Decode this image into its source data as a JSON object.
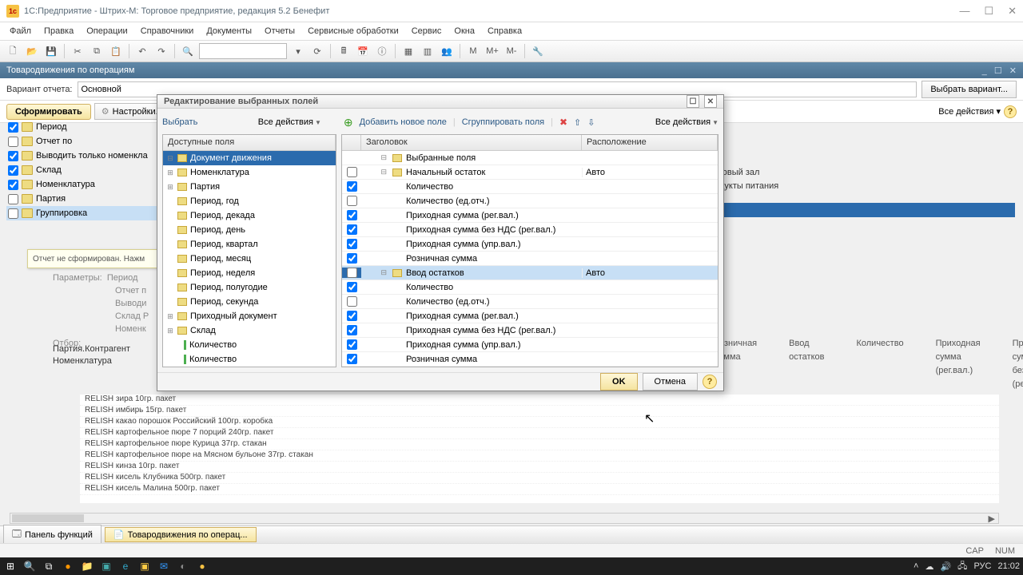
{
  "window": {
    "title": "1С:Предприятие - Штрих-М: Торговое предприятие, редакция 5.2 Бенефит",
    "doc_tab": "Товародвижения по операциям"
  },
  "menu": [
    "Файл",
    "Правка",
    "Операции",
    "Справочники",
    "Документы",
    "Отчеты",
    "Сервисные обработки",
    "Сервис",
    "Окна",
    "Справка"
  ],
  "toolbar_m": [
    "M",
    "M+",
    "M-"
  ],
  "variant": {
    "label": "Вариант отчета:",
    "value": "Основной",
    "choose": "Выбрать вариант..."
  },
  "actions": {
    "run": "Сформировать",
    "settings": "Настройки...",
    "all": "Все действия"
  },
  "left_checks": [
    {
      "checked": true,
      "label": "Период"
    },
    {
      "checked": false,
      "label": "Отчет по"
    },
    {
      "checked": true,
      "label": "Выводить только номенкла"
    },
    {
      "checked": true,
      "label": "Склад"
    },
    {
      "checked": true,
      "label": "Номенклатура"
    },
    {
      "checked": false,
      "label": "Партия"
    },
    {
      "checked": false,
      "label": "Группировка",
      "sel": true
    }
  ],
  "hint": "Отчет не сформирован. Нажм",
  "params": {
    "p_label": "Параметры:",
    "period": "Период",
    "otchet": "Отчет п",
    "vyvod": "Выводи",
    "sklad": "Склад Р",
    "nomen": "Номенк",
    "otbor": "Отбор:",
    "col1": "Партия.Контрагент",
    "col2": "Номенклатура"
  },
  "bg_right": {
    "line1": "говый зал",
    "line2": "дукты питания",
    "cols": [
      "озничная",
      "умма",
      "Ввод остатков",
      "Количество",
      "Приходная",
      "сумма",
      "(рег.вал.)",
      "Приходная сумма",
      "без НДС (рег.вал"
    ]
  },
  "bg_list": [
    "RELISH зира 10гр. пакет",
    "RELISH имбирь 15гр. пакет",
    "RELISH какао порошок Российский 100гр. коробка",
    "RELISH картофельное пюре 7 порций 240гр. пакет",
    "RELISH картофельное пюре Курица 37гр. стакан",
    "RELISH картофельное пюре на Мясном бульоне 37гр. стакан",
    "RELISH кинза 10гр. пакет",
    "RELISH кисель Клубника 500гр. пакет",
    "RELISH кисель Малина 500гр. пакет"
  ],
  "modal": {
    "title": "Редактирование выбранных полей",
    "choose": "Выбрать",
    "all_actions": "Все действия",
    "add_field": "Добавить новое поле",
    "group_fields": "Сгруппировать поля",
    "left_header": "Доступные поля",
    "right_headers": [
      "Заголовок",
      "Расположение"
    ],
    "available": [
      {
        "exp": "⊟",
        "type": "folder",
        "label": "Документ движения",
        "selected": true
      },
      {
        "exp": "⊞",
        "type": "folder",
        "label": "Номенклатура"
      },
      {
        "exp": "⊞",
        "type": "folder",
        "label": "Партия"
      },
      {
        "exp": "",
        "type": "folder",
        "label": "Период, год"
      },
      {
        "exp": "",
        "type": "folder",
        "label": "Период, декада"
      },
      {
        "exp": "",
        "type": "folder",
        "label": "Период, день"
      },
      {
        "exp": "",
        "type": "folder",
        "label": "Период, квартал"
      },
      {
        "exp": "",
        "type": "folder",
        "label": "Период, месяц"
      },
      {
        "exp": "",
        "type": "folder",
        "label": "Период, неделя"
      },
      {
        "exp": "",
        "type": "folder",
        "label": "Период, полугодие"
      },
      {
        "exp": "",
        "type": "folder",
        "label": "Период, секунда"
      },
      {
        "exp": "⊞",
        "type": "folder",
        "label": "Приходный документ"
      },
      {
        "exp": "⊞",
        "type": "folder",
        "label": "Склад"
      },
      {
        "exp": "",
        "type": "green",
        "label": "Количество"
      },
      {
        "exp": "",
        "type": "green",
        "label": "Количество"
      }
    ],
    "selected_root": "Выбранные поля",
    "selected": [
      {
        "chk": false,
        "depth": 1,
        "exp": "⊟",
        "type": "folder",
        "label": "Начальный остаток",
        "loc": "Авто"
      },
      {
        "chk": true,
        "depth": 2,
        "type": "green",
        "label": "Количество",
        "loc": ""
      },
      {
        "chk": false,
        "depth": 2,
        "type": "green",
        "label": "Количество (ед.отч.)",
        "loc": ""
      },
      {
        "chk": true,
        "depth": 2,
        "type": "green",
        "label": "Приходная сумма (рег.вал.)",
        "loc": ""
      },
      {
        "chk": true,
        "depth": 2,
        "type": "green",
        "label": "Приходная сумма без НДС (рег.вал.)",
        "loc": ""
      },
      {
        "chk": true,
        "depth": 2,
        "type": "green",
        "label": "Приходная сумма (упр.вал.)",
        "loc": ""
      },
      {
        "chk": true,
        "depth": 2,
        "type": "green",
        "label": "Розничная сумма",
        "loc": ""
      },
      {
        "chk": false,
        "depth": 1,
        "exp": "⊟",
        "type": "folder",
        "label": "Ввод остатков",
        "loc": "Авто",
        "sel": true
      },
      {
        "chk": true,
        "depth": 2,
        "type": "green",
        "label": "Количество",
        "loc": ""
      },
      {
        "chk": false,
        "depth": 2,
        "type": "green",
        "label": "Количество (ед.отч.)",
        "loc": ""
      },
      {
        "chk": true,
        "depth": 2,
        "type": "green",
        "label": "Приходная сумма (рег.вал.)",
        "loc": ""
      },
      {
        "chk": true,
        "depth": 2,
        "type": "green",
        "label": "Приходная сумма без НДС (рег.вал.)",
        "loc": ""
      },
      {
        "chk": true,
        "depth": 2,
        "type": "green",
        "label": "Приходная сумма (упр.вал.)",
        "loc": ""
      },
      {
        "chk": true,
        "depth": 2,
        "type": "green",
        "label": "Розничная сумма",
        "loc": ""
      }
    ],
    "ok": "OK",
    "cancel": "Отмена"
  },
  "statusbar": {
    "tab1": "Панель функций",
    "tab2": "Товародвижения по операц..."
  },
  "sysstatus": [
    "CAP",
    "NUM"
  ],
  "tray": {
    "lang": "РУС",
    "time": "21:02"
  }
}
